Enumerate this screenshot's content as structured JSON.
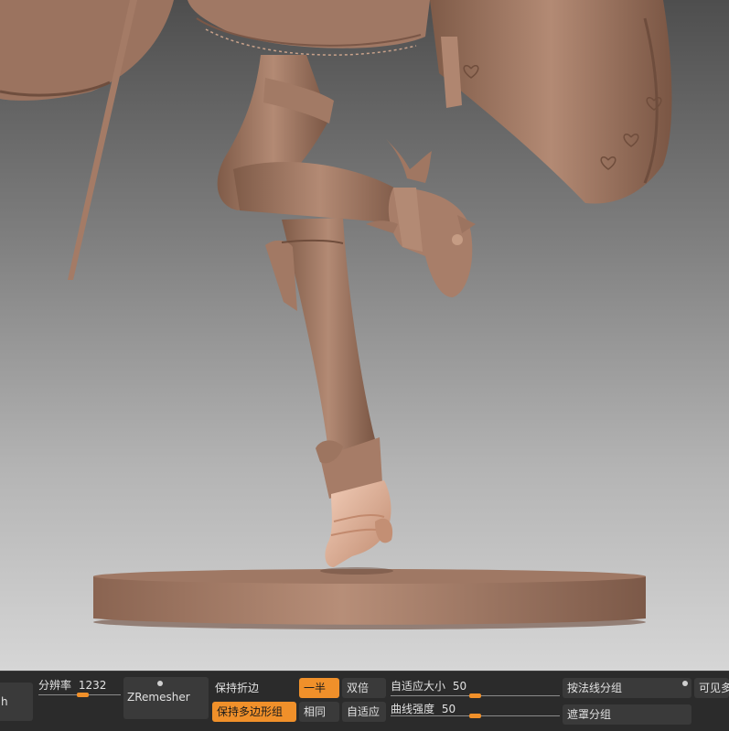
{
  "colors": {
    "accent": "#f0902a",
    "toolbar_bg": "#2b2b2b",
    "button_bg": "#3a3a3a",
    "model_clay": "#a9806a"
  },
  "toolbar": {
    "left_cut_label": "h",
    "resolution_label": "分辨率",
    "resolution_value": "1232",
    "resolution_fraction": 0.55,
    "zremesher_label": "ZRemesher",
    "keep_creases_label": "保持折边",
    "keep_polygroups_label": "保持多边形组",
    "half_label": "一半",
    "double_label": "双倍",
    "same_label": "相同",
    "adaptive_label": "自适应",
    "adaptive_size_label": "自适应大小",
    "adaptive_size_value": "50",
    "adaptive_size_fraction": 0.5,
    "curve_strength_label": "曲线强度",
    "curve_strength_value": "50",
    "curve_strength_fraction": 0.5,
    "polygroups_by_normal_label": "按法线分组",
    "mask_polygroups_label": "遮罩分组",
    "visible_label": "可见多"
  }
}
